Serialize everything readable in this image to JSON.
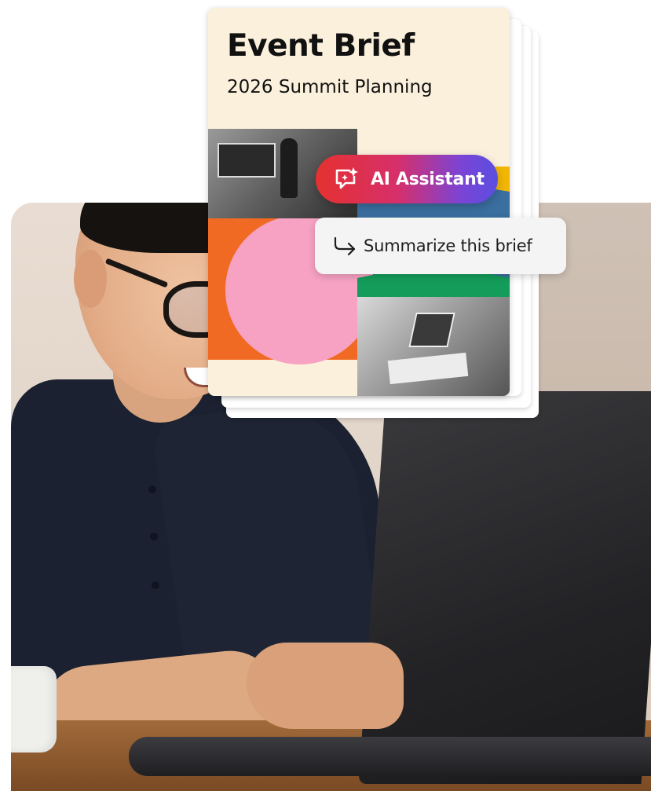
{
  "document": {
    "title": "Event Brief",
    "subtitle": "2026 Summit Planning"
  },
  "assistant": {
    "button_label": "AI Assistant",
    "icon": "ai-sparkle-chat-icon",
    "gradient_colors": [
      "#e5312f",
      "#d62f6b",
      "#7a44d6",
      "#5a4ee0"
    ]
  },
  "suggestion": {
    "label": "Summarize this brief",
    "icon": "arrow-turn-right-icon"
  },
  "collage_colors": {
    "gold": "#f2b705",
    "blue": "#3b6fa0",
    "orange": "#f16a24",
    "pink": "#f7a2c3",
    "green": "#149c5a"
  },
  "photo": {
    "subject": "person-using-laptop"
  }
}
